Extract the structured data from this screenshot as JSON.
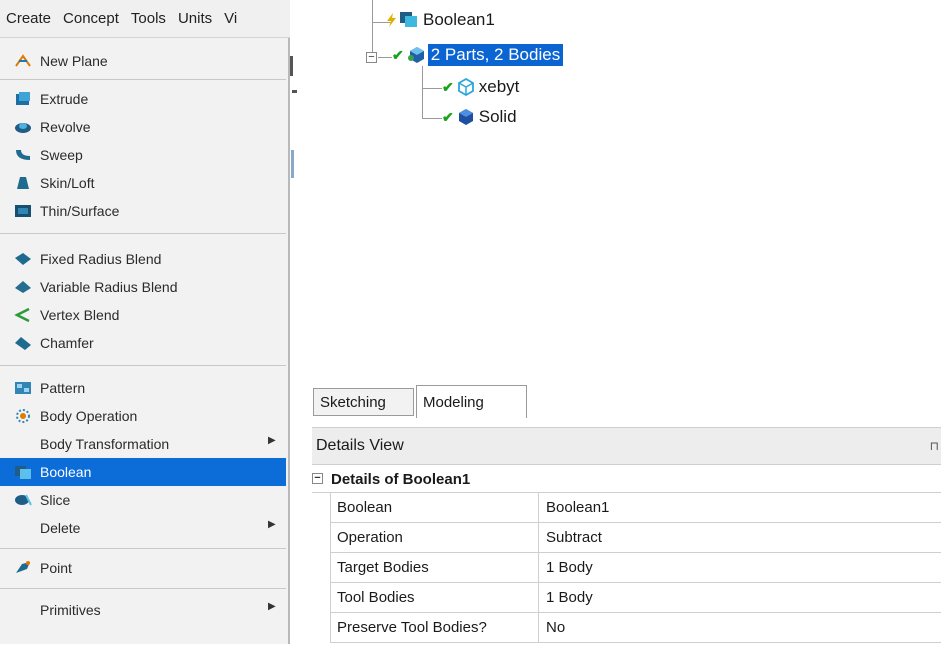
{
  "menubar": {
    "items": [
      "Create",
      "Concept",
      "Tools",
      "Units",
      "Vi"
    ]
  },
  "menu": {
    "items": [
      {
        "label": "New Plane",
        "icon": "new-plane-icon"
      },
      {
        "label": "Extrude",
        "icon": "extrude-icon"
      },
      {
        "label": "Revolve",
        "icon": "revolve-icon"
      },
      {
        "label": "Sweep",
        "icon": "sweep-icon"
      },
      {
        "label": "Skin/Loft",
        "icon": "skin-loft-icon"
      },
      {
        "label": "Thin/Surface",
        "icon": "thin-surface-icon"
      },
      {
        "label": "Fixed Radius Blend",
        "icon": "fixed-radius-blend-icon"
      },
      {
        "label": "Variable Radius Blend",
        "icon": "variable-radius-blend-icon"
      },
      {
        "label": "Vertex Blend",
        "icon": "vertex-blend-icon"
      },
      {
        "label": "Chamfer",
        "icon": "chamfer-icon"
      },
      {
        "label": "Pattern",
        "icon": "pattern-icon"
      },
      {
        "label": "Body Operation",
        "icon": "body-operation-icon"
      },
      {
        "label": "Body Transformation",
        "icon": "",
        "submenu": true
      },
      {
        "label": "Boolean",
        "icon": "boolean-icon",
        "selected": true
      },
      {
        "label": "Slice",
        "icon": "slice-icon"
      },
      {
        "label": "Delete",
        "icon": "",
        "submenu": true
      },
      {
        "label": "Point",
        "icon": "point-icon"
      },
      {
        "label": "Primitives",
        "icon": "",
        "submenu": true
      }
    ],
    "selected_color": "#0c6cd8"
  },
  "tree": {
    "boolean_node": "Boolean1",
    "parts_node": "2 Parts, 2 Bodies",
    "body1": "xebyt",
    "body2": "Solid"
  },
  "tabs": {
    "sketching": "Sketching",
    "modeling": "Modeling"
  },
  "details": {
    "header": "Details View",
    "pin": "⊓",
    "group_title": "Details of Boolean1",
    "group_toggle": "−",
    "rows": [
      {
        "key": "Boolean",
        "value": "Boolean1"
      },
      {
        "key": "Operation",
        "value": "Subtract"
      },
      {
        "key": "Target Bodies",
        "value": "1 Body"
      },
      {
        "key": "Tool Bodies",
        "value": "1 Body"
      },
      {
        "key": "Preserve Tool Bodies?",
        "value": "No"
      }
    ]
  }
}
